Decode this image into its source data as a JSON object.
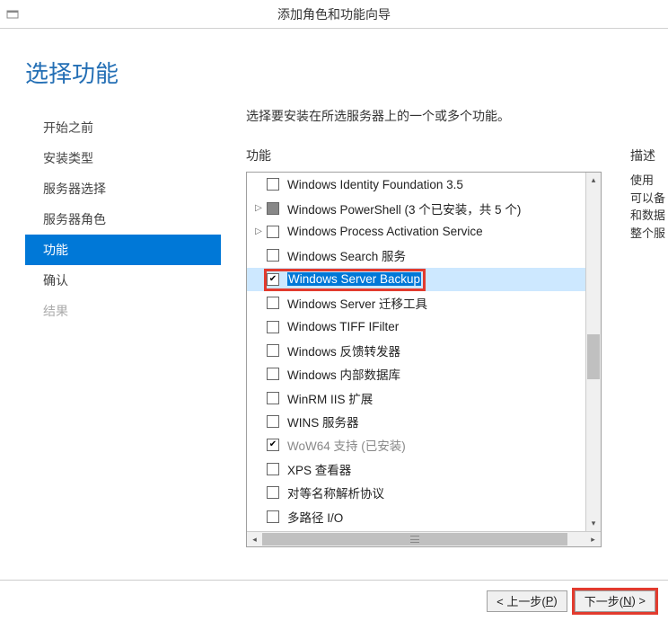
{
  "window": {
    "title": "添加角色和功能向导"
  },
  "header": {
    "title": "选择功能"
  },
  "sidebar": {
    "items": [
      {
        "label": "开始之前",
        "state": "normal"
      },
      {
        "label": "安装类型",
        "state": "normal"
      },
      {
        "label": "服务器选择",
        "state": "normal"
      },
      {
        "label": "服务器角色",
        "state": "normal"
      },
      {
        "label": "功能",
        "state": "active"
      },
      {
        "label": "确认",
        "state": "normal"
      },
      {
        "label": "结果",
        "state": "disabled"
      }
    ]
  },
  "main": {
    "instruction": "选择要安装在所选服务器上的一个或多个功能。",
    "features_label": "功能",
    "description_label": "描述",
    "description_lines": [
      "使用",
      "可以备",
      "和数据",
      "整个服"
    ]
  },
  "features": [
    {
      "label": "Windows Identity Foundation 3.5",
      "checked": false,
      "expandable": false
    },
    {
      "label": "Windows PowerShell (3 个已安装，共 5 个)",
      "checked": "partial",
      "expandable": true
    },
    {
      "label": "Windows Process Activation Service",
      "checked": false,
      "expandable": true
    },
    {
      "label": "Windows Search 服务",
      "checked": false,
      "expandable": false
    },
    {
      "label": "Windows Server Backup",
      "checked": true,
      "expandable": false,
      "selected": true,
      "highlighted": true
    },
    {
      "label": "Windows Server 迁移工具",
      "checked": false,
      "expandable": false
    },
    {
      "label": "Windows TIFF IFilter",
      "checked": false,
      "expandable": false
    },
    {
      "label": "Windows 反馈转发器",
      "checked": false,
      "expandable": false
    },
    {
      "label": "Windows 内部数据库",
      "checked": false,
      "expandable": false
    },
    {
      "label": "WinRM IIS 扩展",
      "checked": false,
      "expandable": false
    },
    {
      "label": "WINS 服务器",
      "checked": false,
      "expandable": false
    },
    {
      "label": "WoW64 支持 (已安装)",
      "checked": true,
      "expandable": false,
      "disabled": true
    },
    {
      "label": "XPS 查看器",
      "checked": false,
      "expandable": false
    },
    {
      "label": "对等名称解析协议",
      "checked": false,
      "expandable": false
    },
    {
      "label": "多路径 I/O",
      "checked": false,
      "expandable": false
    }
  ],
  "footer": {
    "prev_prefix": "< 上一步(",
    "prev_m": "P",
    "prev_suffix": ")",
    "next_prefix": "下一步(",
    "next_m": "N",
    "next_suffix": ") >",
    "next_highlighted": true
  }
}
